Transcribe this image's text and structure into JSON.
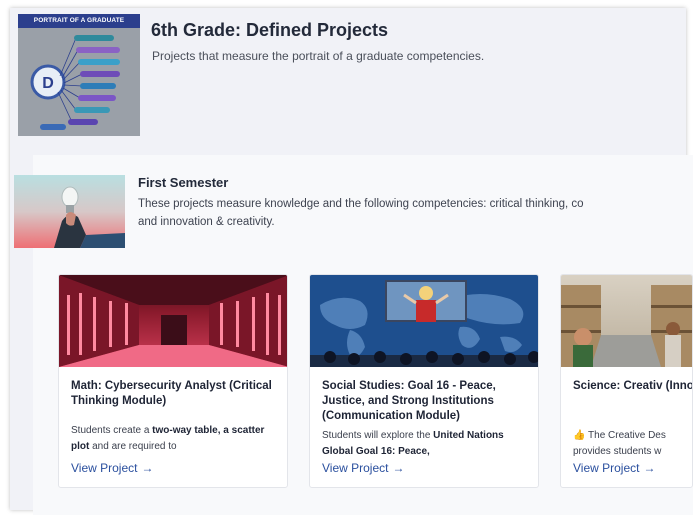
{
  "header": {
    "thumbnail_banner": "PORTRAIT OF A GRADUATE",
    "title": "6th Grade: Defined Projects",
    "subtitle": "Projects that measure the portrait of a graduate competencies."
  },
  "semester": {
    "title": "First Semester",
    "description_line1": "These projects measure knowledge and the following competencies: critical thinking, co",
    "description_line2": "and innovation & creativity."
  },
  "cards": [
    {
      "title": "Math: Cybersecurity Analyst (Critical Thinking Module)",
      "desc_pre": "Students create a ",
      "desc_bold": "two-way table, a scatter plot",
      "desc_post": " and are required to",
      "link": "View Project",
      "link_icon": "arrow-right-icon"
    },
    {
      "title": "Social Studies: Goal 16 - Peace, Justice, and Strong Institutions (Communication Module)",
      "desc_pre": "Students will explore the ",
      "desc_bold": "United Nations Global Goal 16: Peace,",
      "desc_post": "",
      "link": "View Project",
      "link_icon": "arrow-right-icon"
    },
    {
      "title": "Science: Creativ (Innovation & Cr Module)",
      "desc_line1": "👍 The Creative Des",
      "desc_line2": "provides students w",
      "link": "View Project",
      "link_icon": "arrow-right-icon"
    }
  ],
  "colors": {
    "frame_bg": "#f1f2f7",
    "panel_bg": "#f8f9fb",
    "title": "#232a3a",
    "link": "#2a4f9e",
    "banner": "#2c3f8d"
  }
}
